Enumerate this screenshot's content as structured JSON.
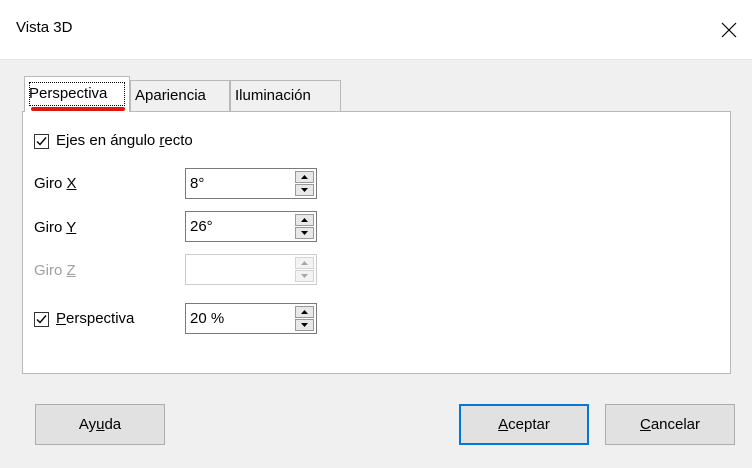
{
  "window": {
    "title": "Vista 3D",
    "close_icon": "close-icon"
  },
  "tabs": [
    {
      "label": "Perspectiva",
      "active": true
    },
    {
      "label": "Apariencia",
      "active": false
    },
    {
      "label": "Iluminación",
      "active": false
    }
  ],
  "perspective_tab": {
    "right_angle_axes": {
      "label_pre": "Ejes en ángulo ",
      "label_mnemonic": "r",
      "label_post": "ecto",
      "checked": true
    },
    "rotation_x": {
      "label_pre": "Giro ",
      "label_mnemonic": "X",
      "value": "8°",
      "enabled": true
    },
    "rotation_y": {
      "label_pre": "Giro ",
      "label_mnemonic": "Y",
      "value": "26°",
      "enabled": true
    },
    "rotation_z": {
      "label_pre": "Giro ",
      "label_mnemonic": "Z",
      "value": "",
      "enabled": false
    },
    "perspective": {
      "label_mnemonic": "P",
      "label_post": "erspectiva",
      "checked": true,
      "value": "20 %"
    }
  },
  "buttons": {
    "help": {
      "pre": "Ay",
      "mnemonic": "u",
      "post": "da"
    },
    "ok": {
      "pre": "",
      "mnemonic": "A",
      "post": "ceptar"
    },
    "cancel": {
      "pre": "",
      "mnemonic": "C",
      "post": "ancelar"
    }
  },
  "colors": {
    "focus_underline": "#e01414",
    "default_button_border": "#0078d7"
  }
}
